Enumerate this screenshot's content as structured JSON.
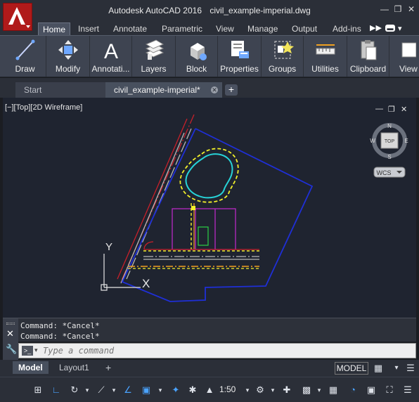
{
  "titlebar": {
    "app": "Autodesk AutoCAD 2016",
    "filename": "civil_example-imperial.dwg"
  },
  "ribbon_tabs": [
    "Home",
    "Insert",
    "Annotate",
    "Parametric",
    "View",
    "Manage",
    "Output",
    "Add-ins"
  ],
  "ribbon_buttons": [
    "Draw",
    "Modify",
    "Annotati...",
    "Layers",
    "Block",
    "Properties",
    "Groups",
    "Utilities",
    "Clipboard",
    "View"
  ],
  "doc_tabs": {
    "start": "Start",
    "current": "civil_example-imperial*"
  },
  "viewport": {
    "label": "[−][Top][2D Wireframe]",
    "viewcube_face": "TOP",
    "compass": {
      "n": "N",
      "s": "S",
      "e": "E",
      "w": "W"
    },
    "wcs": "WCS",
    "ucs_x": "X",
    "ucs_y": "Y"
  },
  "command": {
    "history": [
      "Command: *Cancel*",
      "Command: *Cancel*"
    ],
    "placeholder": "Type a command"
  },
  "layout_tabs": [
    "Model",
    "Layout1"
  ],
  "status": {
    "model": "MODEL",
    "scale": "1:50"
  },
  "colors": {
    "app_red": "#b01a1a",
    "canvas_bg": "#1f2430",
    "boundary_blue": "#1f2fd6",
    "road_red": "#c8202a",
    "road_gray": "#b8b8b8",
    "pond_cyan": "#27d3d8",
    "pond_yellow": "#f2f02a",
    "building_magenta": "#c42ad0",
    "door_green": "#2bd045",
    "road_orange": "#f0a020"
  }
}
